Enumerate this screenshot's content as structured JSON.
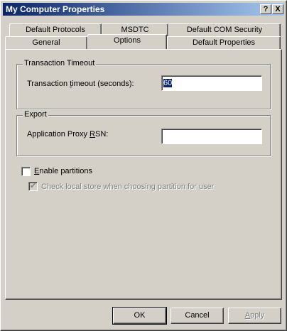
{
  "window": {
    "title": "My Computer Properties",
    "help_btn": "?",
    "close_btn": "X"
  },
  "tabs_back": [
    "Default Protocols",
    "MSDTC",
    "Default COM Security"
  ],
  "tabs_front": [
    "General",
    "Options",
    "Default Properties"
  ],
  "active_tab": "Options",
  "transaction": {
    "group_title": "Transaction Timeout",
    "label": "Transaction timeout (seconds):",
    "value": "60"
  },
  "export": {
    "group_title": "Export",
    "label": "Application Proxy RSN:",
    "value": ""
  },
  "partitions": {
    "enable_label": "Enable partitions",
    "enable_checked": false,
    "check_local_label": "Check local store when choosing partition for user",
    "check_local_checked": true
  },
  "buttons": {
    "ok": "OK",
    "cancel": "Cancel",
    "apply": "Apply"
  }
}
